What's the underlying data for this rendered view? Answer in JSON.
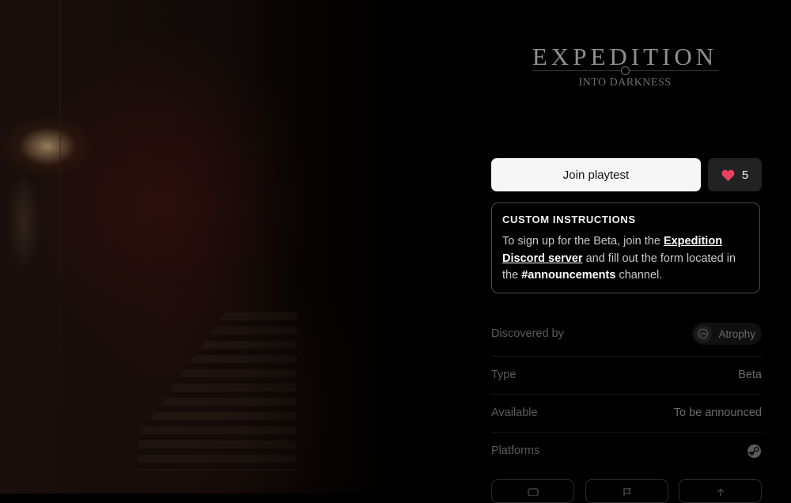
{
  "logo": {
    "title": "EXPEDITION",
    "subtitle": "INTO DARKNESS"
  },
  "actions": {
    "join_label": "Join playtest",
    "like_count": "5",
    "heart_color": "#e8425f"
  },
  "instructions": {
    "heading": "CUSTOM INSTRUCTIONS",
    "text_1": "To sign up for the Beta, join the ",
    "link": "Expedition Discord server",
    "text_2": " and fill out the form located in the ",
    "channel": "#announcements",
    "text_3": " channel."
  },
  "details": {
    "discovered_label": "Discovered by",
    "discovered_value": "Atrophy",
    "type_label": "Type",
    "type_value": "Beta",
    "available_label": "Available",
    "available_value": "To be announced",
    "platforms_label": "Platforms",
    "platform_icon": "steam-icon"
  },
  "bottom_tabs": [
    "chat-icon",
    "flag-icon",
    "share-icon"
  ]
}
